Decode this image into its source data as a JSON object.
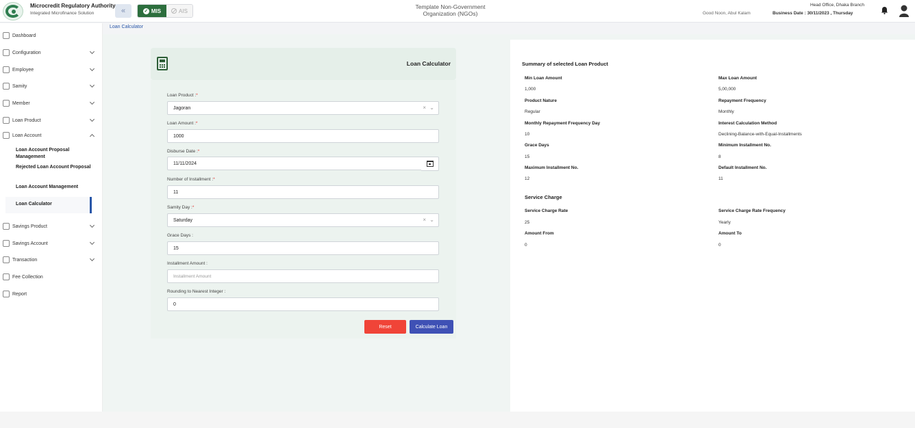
{
  "header": {
    "org_title": "Microcredit Regulatory Authority",
    "org_subtitle": "Integrated Microfinance Solution",
    "mode_mis": "MIS",
    "mode_ais": "AIS",
    "template_title_line1": "Template Non-Government",
    "template_title_line2": "Organization (NGOs)",
    "greeting": "Good Noon, Abul Kalam",
    "branch": "Head Office, Dhaka Branch",
    "business_date": "Business Date : 30/11/2023 , Thursday"
  },
  "sidebar": {
    "items": [
      {
        "label": "Dashboard"
      },
      {
        "label": "Configuration"
      },
      {
        "label": "Employee"
      },
      {
        "label": "Samity"
      },
      {
        "label": "Member"
      },
      {
        "label": "Loan Product"
      },
      {
        "label": "Loan Account"
      },
      {
        "label": "Savings Product"
      },
      {
        "label": "Savings Account"
      },
      {
        "label": "Transaction"
      },
      {
        "label": "Fee Collection"
      },
      {
        "label": "Report"
      }
    ],
    "sub_items": [
      {
        "label": "Loan Account Proposal Management"
      },
      {
        "label": "Rejected Loan Account Proposal"
      },
      {
        "label": "Loan Account Management"
      },
      {
        "label": "Loan Calculator"
      }
    ]
  },
  "breadcrumb": "Loan Calculator",
  "calculator": {
    "title": "Loan Calculator",
    "fields": {
      "loan_product": {
        "label": "Loan Product :",
        "required": "*",
        "value": "Jagoran"
      },
      "loan_amount": {
        "label": "Loan Amount :",
        "required": "*",
        "value": "1000"
      },
      "disburse_date": {
        "label": "Disburse Date :",
        "required": "*",
        "value": "11/11/2024"
      },
      "num_installment": {
        "label": "Number of Installment :",
        "required": "*",
        "value": "11"
      },
      "samity_day": {
        "label": "Samity Day :",
        "required": "*",
        "value": "Saturday"
      },
      "grace_days": {
        "label": "Grace Days :",
        "value": "15"
      },
      "installment_amount": {
        "label": "Installment Amount :",
        "placeholder": "Installment Amount"
      },
      "rounding": {
        "label": "Rounding to Nearest Integer :",
        "value": "0"
      }
    },
    "reset_label": "Reset",
    "calculate_label": "Calculate Loan"
  },
  "summary": {
    "title": "Summary of selected Loan Product",
    "rows": [
      {
        "left_label": "Min Loan Amount",
        "left_value": "1,000",
        "right_label": "Max Loan Amount",
        "right_value": "5,00,000"
      },
      {
        "left_label": "Product Nature",
        "left_value": "Regular",
        "right_label": "Repayment Frequency",
        "right_value": "Monthly"
      },
      {
        "left_label": "Monthly Repayment Frequency Day",
        "left_value": "10",
        "right_label": "Interest Calculation Method",
        "right_value": "Declining-Balance-with-Equal-Installments"
      },
      {
        "left_label": "Grace Days",
        "left_value": "15",
        "right_label": "Minimum Installment No.",
        "right_value": "8"
      },
      {
        "left_label": "Maximum Installment No.",
        "left_value": "12",
        "right_label": "Default Installment No.",
        "right_value": "11"
      }
    ],
    "service_charge_title": "Service Charge",
    "service_rows": [
      {
        "left_label": "Service Charge Rate",
        "left_value": "25",
        "right_label": "Service Charge Rate Frequency",
        "right_value": "Yearly"
      },
      {
        "left_label": "Amount From",
        "left_value": "0",
        "right_label": "Amount To",
        "right_value": "0"
      }
    ]
  }
}
